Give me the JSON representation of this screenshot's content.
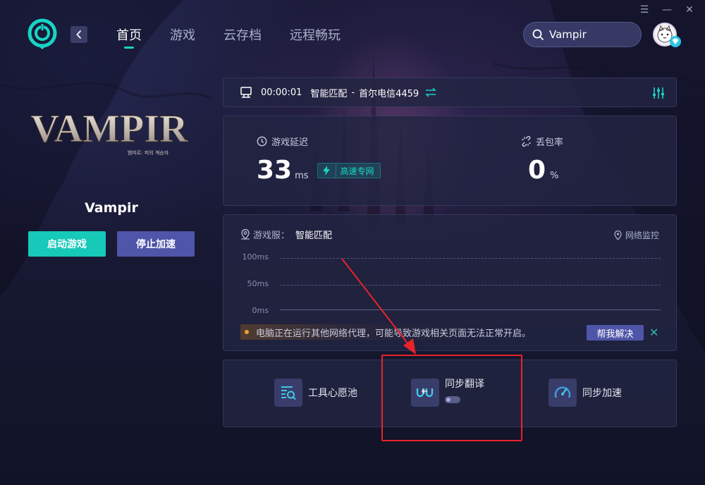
{
  "window": {
    "menu_glyph": "☰",
    "minimize_glyph": "—",
    "close_glyph": "✕"
  },
  "header": {
    "back_glyph": "‹",
    "nav": [
      {
        "label": "首页",
        "active": true
      },
      {
        "label": "游戏",
        "active": false
      },
      {
        "label": "云存档",
        "active": false
      },
      {
        "label": "远程畅玩",
        "active": false
      }
    ],
    "search": {
      "value": "Vampir"
    }
  },
  "game": {
    "logo_text": "VAMPIR",
    "logo_subtext": "뱀피르: 피의 계승자",
    "title": "Vampir",
    "start_label": "启动游戏",
    "stop_label": "停止加速"
  },
  "connection": {
    "elapsed": "00:00:01",
    "mode": "智能匹配",
    "separator": "-",
    "node": "首尔电信4459"
  },
  "stats": {
    "latency": {
      "label": "游戏延迟",
      "value": "33",
      "unit": "ms",
      "tag": "高速专网"
    },
    "loss": {
      "label": "丢包率",
      "value": "0",
      "unit": "%"
    }
  },
  "graph": {
    "server_label": "游戏服：",
    "server_value": "智能匹配",
    "monitor_label": "网络监控",
    "y_ticks": [
      "100ms",
      "50ms",
      "0ms"
    ],
    "warning": "电脑正在运行其他网络代理，可能导致游戏相关页面无法正常开启。",
    "help_label": "帮我解决",
    "dismiss_glyph": "✕"
  },
  "tools": [
    {
      "label": "工具心愿池",
      "icon": "wishlist-search-icon"
    },
    {
      "label": "同步翻译",
      "icon": "translate-icon",
      "toggle_on": false
    },
    {
      "label": "同步加速",
      "icon": "speed-gauge-icon"
    }
  ],
  "colors": {
    "accent": "#17d4c4",
    "primary_button": "#4f55a8",
    "annotation": "#e8232a"
  }
}
